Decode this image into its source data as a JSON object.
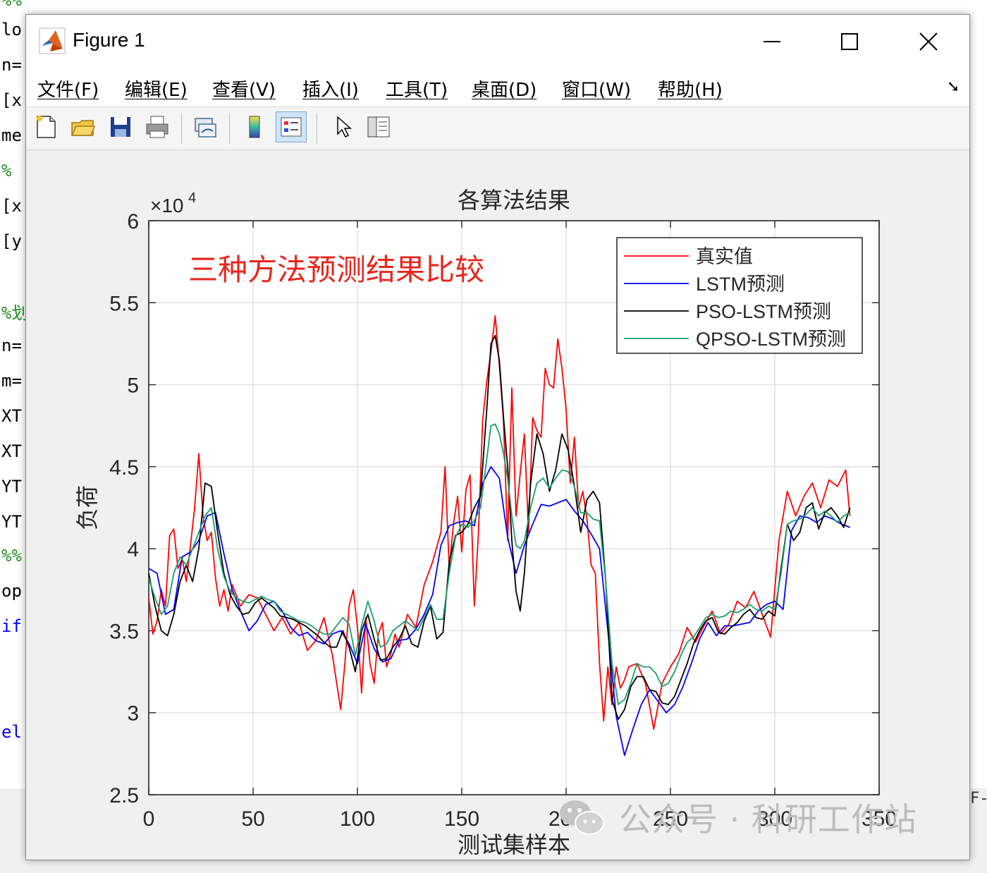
{
  "editor": {
    "lines": [
      {
        "text": "%%",
        "top": -14,
        "color": "#228b22"
      },
      {
        "text": "lo",
        "top": 28,
        "color": "#000000"
      },
      {
        "text": "n=",
        "top": 78,
        "color": "#000000"
      },
      {
        "text": "[x",
        "top": 128,
        "color": "#000000"
      },
      {
        "text": "me",
        "top": 178,
        "color": "#000000"
      },
      {
        "text": "%",
        "top": 228,
        "color": "#228b22"
      },
      {
        "text": "[x",
        "top": 278,
        "color": "#000000"
      },
      {
        "text": "[y",
        "top": 328,
        "color": "#000000"
      },
      {
        "text": "%划",
        "top": 424,
        "color": "#228b22"
      },
      {
        "text": "n=",
        "top": 476,
        "color": "#000000"
      },
      {
        "text": "m=",
        "top": 526,
        "color": "#000000"
      },
      {
        "text": "XT",
        "top": 576,
        "color": "#000000"
      },
      {
        "text": "XT",
        "top": 626,
        "color": "#000000"
      },
      {
        "text": "YT",
        "top": 676,
        "color": "#000000"
      },
      {
        "text": "YT",
        "top": 726,
        "color": "#000000"
      },
      {
        "text": "%%",
        "top": 774,
        "color": "#228b22"
      },
      {
        "text": "op",
        "top": 824,
        "color": "#000000"
      },
      {
        "text": "if",
        "top": 874,
        "color": "#0000ff"
      },
      {
        "text": "el",
        "top": 1024,
        "color": "#0000ff"
      }
    ],
    "right_edge_text": "F-"
  },
  "window": {
    "title": "Figure 1",
    "menus": [
      "文件(F)",
      "编辑(E)",
      "查看(V)",
      "插入(I)",
      "工具(T)",
      "桌面(D)",
      "窗口(W)",
      "帮助(H)"
    ]
  },
  "toolbar": {
    "buttons": [
      "new-figure-icon",
      "open-file-icon",
      "save-icon",
      "print-icon",
      "link-plot-icon",
      "colorbar-icon",
      "legend-icon",
      "pointer-icon",
      "property-inspector-icon"
    ]
  },
  "watermark": {
    "text": "公众号 · 科研工作站"
  },
  "colors": {
    "real": "#ff0000",
    "lstm": "#0000ff",
    "pso": "#000000",
    "qpso": "#1a9e6a",
    "annotation": "#e8261e"
  },
  "chart_data": {
    "type": "line",
    "title": "各算法结果",
    "xlabel": "测试集样本",
    "ylabel": "负荷",
    "exponent_label": "×10",
    "exponent_power": "4",
    "annotation": "三种方法预测结果比较",
    "xlim": [
      0,
      350
    ],
    "ylim": [
      25000,
      60000
    ],
    "xticks": [
      0,
      50,
      100,
      150,
      200,
      250,
      300,
      350
    ],
    "yticks": [
      25000,
      30000,
      35000,
      40000,
      45000,
      50000,
      55000,
      60000
    ],
    "ytick_labels": [
      "2.5",
      "3",
      "3.5",
      "4",
      "4.5",
      "5",
      "5.5",
      "6"
    ],
    "grid": true,
    "legend_position": "top-right",
    "series": [
      {
        "name": "真实值",
        "color": "#ff0000",
        "x": [
          0,
          2,
          4,
          6,
          8,
          10,
          12,
          14,
          16,
          18,
          20,
          22,
          24,
          26,
          28,
          30,
          32,
          34,
          36,
          38,
          40,
          44,
          48,
          52,
          56,
          60,
          64,
          68,
          72,
          76,
          80,
          84,
          88,
          92,
          94,
          96,
          98,
          100,
          102,
          104,
          106,
          108,
          110,
          112,
          114,
          116,
          118,
          120,
          124,
          128,
          132,
          136,
          140,
          142,
          144,
          146,
          148,
          150,
          152,
          154,
          156,
          158,
          160,
          162,
          164,
          166,
          168,
          170,
          172,
          174,
          176,
          178,
          180,
          182,
          184,
          186,
          188,
          190,
          192,
          194,
          196,
          198,
          200,
          202,
          204,
          206,
          208,
          210,
          212,
          214,
          216,
          218,
          220,
          222,
          224,
          226,
          228,
          230,
          234,
          238,
          242,
          246,
          250,
          254,
          258,
          262,
          266,
          270,
          274,
          278,
          282,
          286,
          290,
          294,
          298,
          302,
          306,
          310,
          314,
          318,
          322,
          326,
          330,
          334,
          336
        ],
        "y": [
          37000,
          34800,
          35600,
          37500,
          36500,
          40800,
          41200,
          38800,
          39400,
          38000,
          40200,
          42500,
          45800,
          42000,
          40500,
          41000,
          38200,
          36500,
          37500,
          36200,
          37800,
          36500,
          37200,
          37000,
          36000,
          35000,
          35800,
          34800,
          35500,
          33800,
          34400,
          35800,
          33500,
          30200,
          33000,
          36500,
          37500,
          35200,
          31200,
          35800,
          33000,
          31800,
          34800,
          35500,
          32800,
          33600,
          34800,
          34000,
          36000,
          35200,
          37800,
          39200,
          41000,
          45000,
          38800,
          41500,
          43200,
          39800,
          43600,
          44500,
          36500,
          41000,
          47800,
          50200,
          52000,
          54200,
          51200,
          47800,
          40500,
          49800,
          42000,
          44600,
          47000,
          41000,
          48000,
          47200,
          46800,
          51000,
          50000,
          49800,
          52800,
          51000,
          48500,
          44000,
          46800,
          42500,
          43500,
          41800,
          39000,
          38500,
          33000,
          29500,
          32800,
          30500,
          32800,
          31500,
          32000,
          32800,
          33000,
          31800,
          29000,
          31800,
          32800,
          33600,
          35200,
          34300,
          35300,
          36200,
          34800,
          35400,
          36800,
          36400,
          37400,
          36000,
          34600,
          40500,
          43500,
          42000,
          43200,
          44000,
          42500,
          44200,
          43800,
          44800,
          42000
        ]
      },
      {
        "name": "LSTM预测",
        "color": "#0000ff",
        "x": [
          0,
          4,
          8,
          12,
          16,
          20,
          24,
          28,
          32,
          36,
          40,
          44,
          48,
          52,
          56,
          60,
          64,
          68,
          72,
          76,
          80,
          84,
          88,
          92,
          96,
          100,
          104,
          108,
          112,
          116,
          120,
          124,
          128,
          132,
          136,
          140,
          144,
          148,
          152,
          156,
          160,
          164,
          168,
          172,
          176,
          180,
          184,
          188,
          192,
          196,
          200,
          204,
          208,
          212,
          216,
          220,
          224,
          228,
          232,
          236,
          240,
          244,
          248,
          252,
          256,
          260,
          264,
          268,
          272,
          276,
          280,
          284,
          288,
          292,
          296,
          300,
          304,
          308,
          312,
          316,
          320,
          324,
          328,
          332,
          336
        ],
        "y": [
          38800,
          38500,
          36000,
          36300,
          39500,
          39800,
          40500,
          42000,
          42200,
          39700,
          37500,
          36200,
          35000,
          35600,
          36600,
          36800,
          36200,
          35200,
          34700,
          34900,
          34400,
          34200,
          34800,
          35000,
          34200,
          33000,
          35400,
          33900,
          33100,
          33300,
          34400,
          34500,
          35100,
          36000,
          37200,
          40200,
          41400,
          41600,
          41700,
          41400,
          44000,
          45000,
          44300,
          40700,
          38500,
          40200,
          41500,
          42700,
          42600,
          42800,
          43000,
          42300,
          41700,
          40900,
          40000,
          35000,
          29800,
          27400,
          29000,
          30500,
          31400,
          30700,
          30000,
          30500,
          31600,
          33000,
          34500,
          35500,
          34700,
          35300,
          35300,
          35400,
          35500,
          36200,
          36600,
          36800,
          36300,
          41100,
          42000,
          41900,
          41600,
          42000,
          41800,
          41500,
          41300
        ]
      },
      {
        "name": "PSO-LSTM预测",
        "color": "#000000",
        "x": [
          0,
          3,
          6,
          9,
          12,
          15,
          18,
          21,
          24,
          27,
          30,
          33,
          36,
          39,
          42,
          45,
          48,
          51,
          54,
          57,
          60,
          63,
          66,
          69,
          72,
          75,
          78,
          81,
          84,
          87,
          90,
          93,
          96,
          99,
          102,
          105,
          108,
          111,
          114,
          117,
          120,
          123,
          126,
          129,
          132,
          135,
          138,
          141,
          144,
          147,
          150,
          153,
          156,
          159,
          162,
          164,
          166,
          168,
          170,
          172,
          174,
          176,
          178,
          180,
          183,
          186,
          189,
          192,
          195,
          198,
          201,
          204,
          207,
          210,
          213,
          216,
          219,
          222,
          225,
          228,
          231,
          234,
          237,
          240,
          243,
          246,
          249,
          252,
          255,
          258,
          261,
          264,
          267,
          270,
          273,
          276,
          279,
          282,
          285,
          288,
          291,
          294,
          297,
          300,
          303,
          306,
          309,
          312,
          315,
          318,
          321,
          324,
          327,
          330,
          333,
          336
        ],
        "y": [
          38500,
          36500,
          35000,
          34700,
          36000,
          38000,
          39000,
          38000,
          40000,
          44000,
          43800,
          41000,
          38500,
          37200,
          36500,
          36000,
          36100,
          36700,
          37000,
          36700,
          36400,
          35900,
          35800,
          35700,
          35500,
          35300,
          35000,
          34700,
          34300,
          34000,
          34000,
          35000,
          34000,
          32500,
          35000,
          36000,
          34500,
          33200,
          33300,
          34000,
          34500,
          35300,
          34200,
          34000,
          35600,
          36500,
          34500,
          34900,
          39200,
          40800,
          41000,
          41500,
          42500,
          43200,
          48500,
          52500,
          53000,
          51500,
          48000,
          45000,
          40500,
          37400,
          36200,
          38500,
          44000,
          47000,
          45800,
          43500,
          44800,
          47000,
          46000,
          43800,
          41000,
          43000,
          43500,
          42800,
          38000,
          30800,
          29600,
          30200,
          31600,
          32200,
          32200,
          31400,
          31300,
          30600,
          30500,
          31000,
          32000,
          33000,
          34200,
          35000,
          35600,
          35800,
          34900,
          34800,
          35200,
          35500,
          36000,
          36300,
          35800,
          35700,
          36200,
          35900,
          38800,
          41500,
          40500,
          41000,
          42500,
          42800,
          41200,
          42200,
          42500,
          42000,
          41300,
          42500
        ]
      },
      {
        "name": "QPSO-LSTM预测",
        "color": "#1a9e6a",
        "x": [
          0,
          3,
          6,
          9,
          12,
          15,
          18,
          21,
          24,
          27,
          30,
          33,
          36,
          39,
          42,
          45,
          48,
          51,
          54,
          57,
          60,
          63,
          66,
          69,
          72,
          75,
          78,
          81,
          84,
          87,
          90,
          93,
          96,
          99,
          102,
          105,
          108,
          111,
          114,
          117,
          120,
          123,
          126,
          129,
          132,
          135,
          138,
          141,
          144,
          147,
          150,
          153,
          156,
          159,
          162,
          164,
          166,
          168,
          170,
          172,
          174,
          176,
          178,
          180,
          183,
          186,
          189,
          192,
          195,
          198,
          201,
          204,
          207,
          210,
          213,
          216,
          219,
          222,
          225,
          228,
          231,
          234,
          237,
          240,
          243,
          246,
          249,
          252,
          255,
          258,
          261,
          264,
          267,
          270,
          273,
          276,
          279,
          282,
          285,
          288,
          291,
          294,
          297,
          300,
          303,
          306,
          309,
          312,
          315,
          318,
          321,
          324,
          327,
          330,
          333,
          336
        ],
        "y": [
          38200,
          37000,
          36000,
          36500,
          38500,
          39500,
          39000,
          40000,
          41000,
          42000,
          42500,
          40000,
          38300,
          37400,
          37000,
          36800,
          36700,
          36900,
          37100,
          36900,
          36800,
          36200,
          36000,
          35800,
          35600,
          35500,
          35300,
          35000,
          34800,
          34800,
          35300,
          35800,
          35400,
          33500,
          35300,
          36800,
          35600,
          34000,
          34200,
          35000,
          35300,
          35600,
          35300,
          35000,
          35800,
          36600,
          35700,
          35700,
          38500,
          40700,
          41500,
          41300,
          41700,
          42500,
          45500,
          47500,
          47600,
          47000,
          45800,
          44300,
          42000,
          40200,
          40000,
          40500,
          42500,
          44000,
          44300,
          43700,
          44300,
          44800,
          44700,
          43800,
          42200,
          42200,
          41800,
          41700,
          38000,
          33000,
          30500,
          30800,
          31800,
          33000,
          32800,
          32800,
          32400,
          31600,
          31800,
          32500,
          33500,
          34300,
          34600,
          35200,
          35800,
          36000,
          35800,
          35900,
          36200,
          36100,
          36300,
          36600,
          36300,
          36200,
          36500,
          36300,
          38500,
          41500,
          41700,
          41800,
          42100,
          42500,
          42000,
          42300,
          42000,
          41600,
          42000,
          42200
        ]
      }
    ]
  }
}
